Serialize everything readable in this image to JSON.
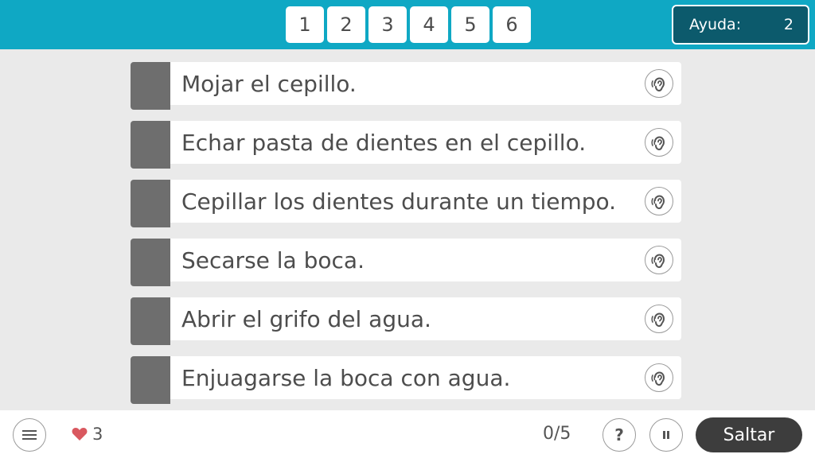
{
  "header": {
    "slots": [
      "1",
      "2",
      "3",
      "4",
      "5",
      "6"
    ],
    "help_label": "Ayuda:",
    "help_count": "2"
  },
  "steps": [
    {
      "text": "Mojar el cepillo.",
      "icon": "ear-icon"
    },
    {
      "text": "Echar pasta de dientes en el cepillo.",
      "icon": "ear-icon"
    },
    {
      "text": "Cepillar los dientes durante un tiempo.",
      "icon": "ear-icon"
    },
    {
      "text": "Secarse la boca.",
      "icon": "ear-icon"
    },
    {
      "text": "Abrir el grifo del agua.",
      "icon": "ear-icon"
    },
    {
      "text": "Enjuagarse la boca con agua.",
      "icon": "ear-icon"
    }
  ],
  "footer": {
    "lives": "3",
    "progress": "0/5",
    "help_symbol": "?",
    "skip_label": "Saltar"
  },
  "colors": {
    "header_bg": "#0fa8c4",
    "help_box_bg": "#0c5a6c",
    "handle": "#6e6e6e",
    "heart": "#d9585f",
    "skip_bg": "#3d3d3d"
  }
}
